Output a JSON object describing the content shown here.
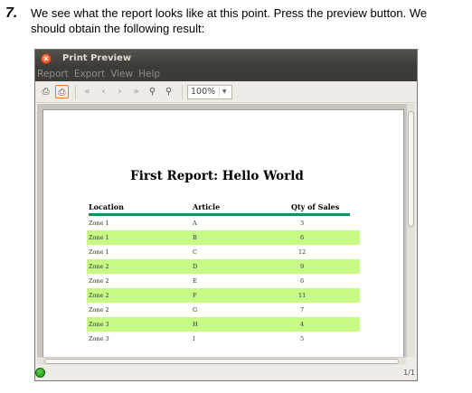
{
  "step": {
    "number": "7.",
    "text": "We see what the report looks like at this point. Press the preview button. We should obtain the following result:"
  },
  "window": {
    "title": "Print Preview",
    "close_glyph": "×",
    "menu": [
      "Report",
      "Export",
      "View",
      "Help"
    ],
    "toolbar": {
      "icons": [
        "print-icon",
        "print-setup-icon",
        "first-page-icon",
        "previous-page-icon",
        "next-page-icon",
        "last-page-icon",
        "zoom-in-icon",
        "zoom-out-icon"
      ],
      "zoom_value": "100%"
    },
    "status": {
      "page_count": "1/1"
    }
  },
  "report": {
    "title": "First Report: Hello World",
    "columns": [
      "Location",
      "Article",
      "Qty of Sales"
    ],
    "rows": [
      [
        "Zone 1",
        "A",
        "3"
      ],
      [
        "Zone 1",
        "B",
        "6"
      ],
      [
        "Zone 1",
        "C",
        "12"
      ],
      [
        "Zone 2",
        "D",
        "9"
      ],
      [
        "Zone 2",
        "E",
        "6"
      ],
      [
        "Zone 2",
        "F",
        "11"
      ],
      [
        "Zone 2",
        "G",
        "7"
      ],
      [
        "Zone 3",
        "H",
        "4"
      ],
      [
        "Zone 3",
        "I",
        "5"
      ]
    ],
    "header_line_color": "#168f5a",
    "alt_row_color": "#c6fb86"
  }
}
